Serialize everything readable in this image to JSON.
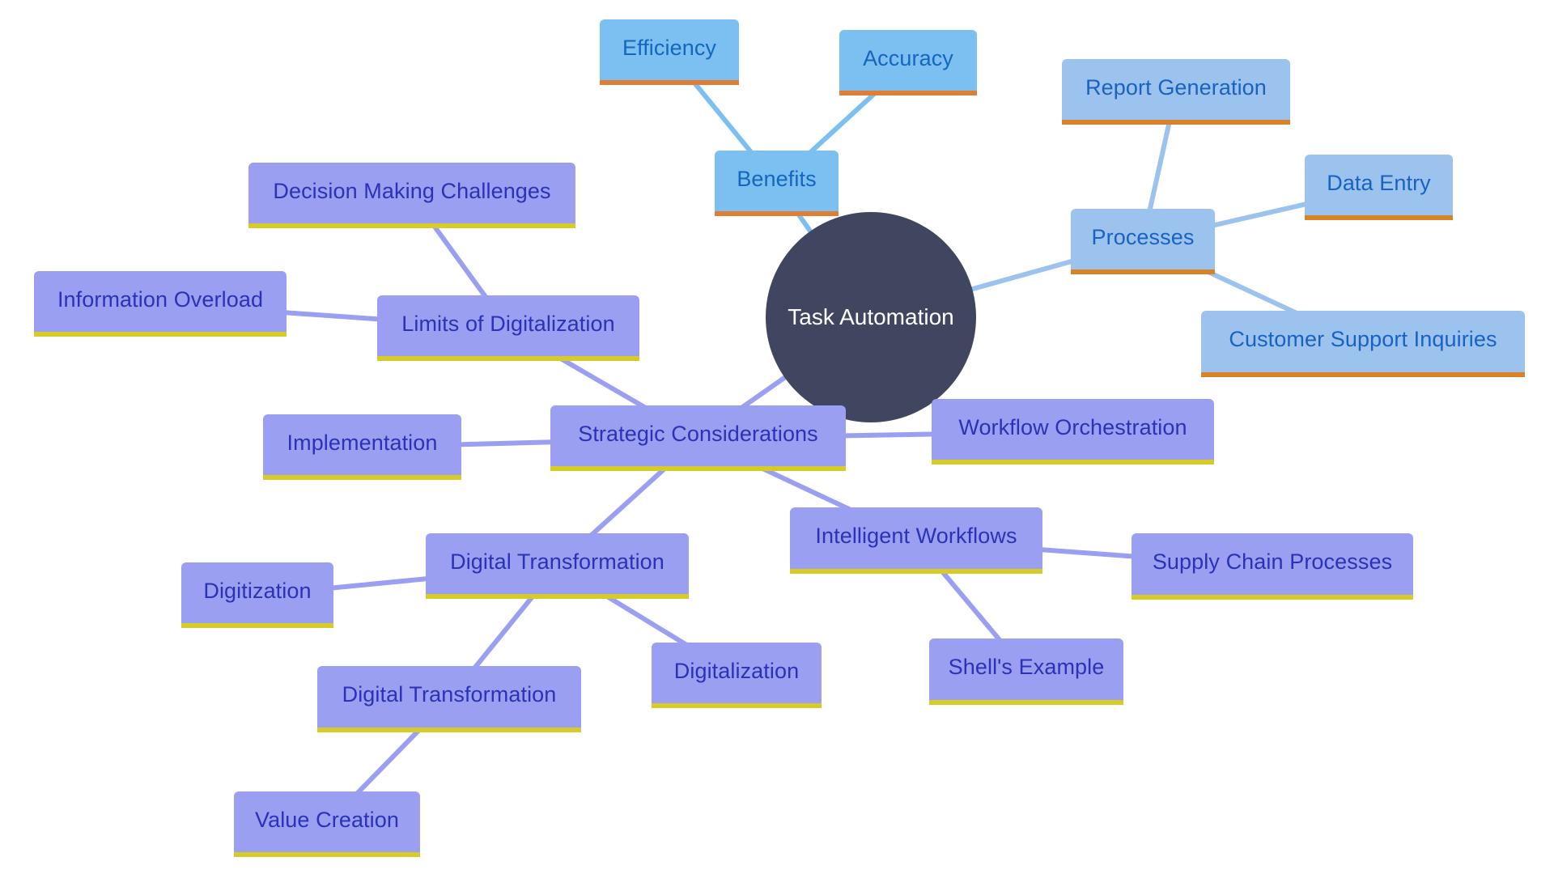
{
  "diagram": {
    "type": "mindmap",
    "root": {
      "id": "root",
      "label": "Task Automation",
      "color": "#414660"
    },
    "branch_styles": {
      "blue": {
        "fill": "#7CBFF1",
        "text": "#1367BE",
        "underline": "#E07E35",
        "edge": "#7CBFF1"
      },
      "light": {
        "fill": "#9CC3EE",
        "text": "#1A62C2",
        "underline": "#D88327",
        "edge": "#9CC3EE"
      },
      "purple": {
        "fill": "#9A9FF1",
        "text": "#2B32B6",
        "underline": "#D7CC27",
        "edge": "#9A9FF1"
      }
    },
    "nodes": [
      {
        "id": "benefits",
        "label": "Benefits",
        "parent": "root",
        "style": "blue"
      },
      {
        "id": "efficiency",
        "label": "Efficiency",
        "parent": "benefits",
        "style": "blue"
      },
      {
        "id": "accuracy",
        "label": "Accuracy",
        "parent": "benefits",
        "style": "blue"
      },
      {
        "id": "processes",
        "label": "Processes",
        "parent": "root",
        "style": "light"
      },
      {
        "id": "report-generation",
        "label": "Report Generation",
        "parent": "processes",
        "style": "light"
      },
      {
        "id": "data-entry",
        "label": "Data Entry",
        "parent": "processes",
        "style": "light"
      },
      {
        "id": "customer-support-inquiries",
        "label": "Customer Support Inquiries",
        "parent": "processes",
        "style": "light"
      },
      {
        "id": "strategic-considerations",
        "label": "Strategic Considerations",
        "parent": "root",
        "style": "purple"
      },
      {
        "id": "limits-of-digitalization",
        "label": "Limits of Digitalization",
        "parent": "strategic-considerations",
        "style": "purple"
      },
      {
        "id": "decision-making-challenges",
        "label": "Decision Making Challenges",
        "parent": "limits-of-digitalization",
        "style": "purple"
      },
      {
        "id": "information-overload",
        "label": "Information Overload",
        "parent": "limits-of-digitalization",
        "style": "purple"
      },
      {
        "id": "implementation",
        "label": "Implementation",
        "parent": "strategic-considerations",
        "style": "purple"
      },
      {
        "id": "workflow-orchestration",
        "label": "Workflow Orchestration",
        "parent": "strategic-considerations",
        "style": "purple"
      },
      {
        "id": "intelligent-workflows",
        "label": "Intelligent Workflows",
        "parent": "strategic-considerations",
        "style": "purple"
      },
      {
        "id": "supply-chain-processes",
        "label": "Supply Chain Processes",
        "parent": "intelligent-workflows",
        "style": "purple"
      },
      {
        "id": "shells-example",
        "label": "Shell's Example",
        "parent": "intelligent-workflows",
        "style": "purple"
      },
      {
        "id": "digital-transformation",
        "label": "Digital Transformation",
        "parent": "strategic-considerations",
        "style": "purple"
      },
      {
        "id": "digitization",
        "label": "Digitization",
        "parent": "digital-transformation",
        "style": "purple"
      },
      {
        "id": "digitalization",
        "label": "Digitalization",
        "parent": "digital-transformation",
        "style": "purple"
      },
      {
        "id": "digital-transformation-2",
        "label": "Digital Transformation",
        "parent": "digital-transformation",
        "style": "purple"
      },
      {
        "id": "value-creation",
        "label": "Value Creation",
        "parent": "digital-transformation-2",
        "style": "purple"
      }
    ]
  }
}
